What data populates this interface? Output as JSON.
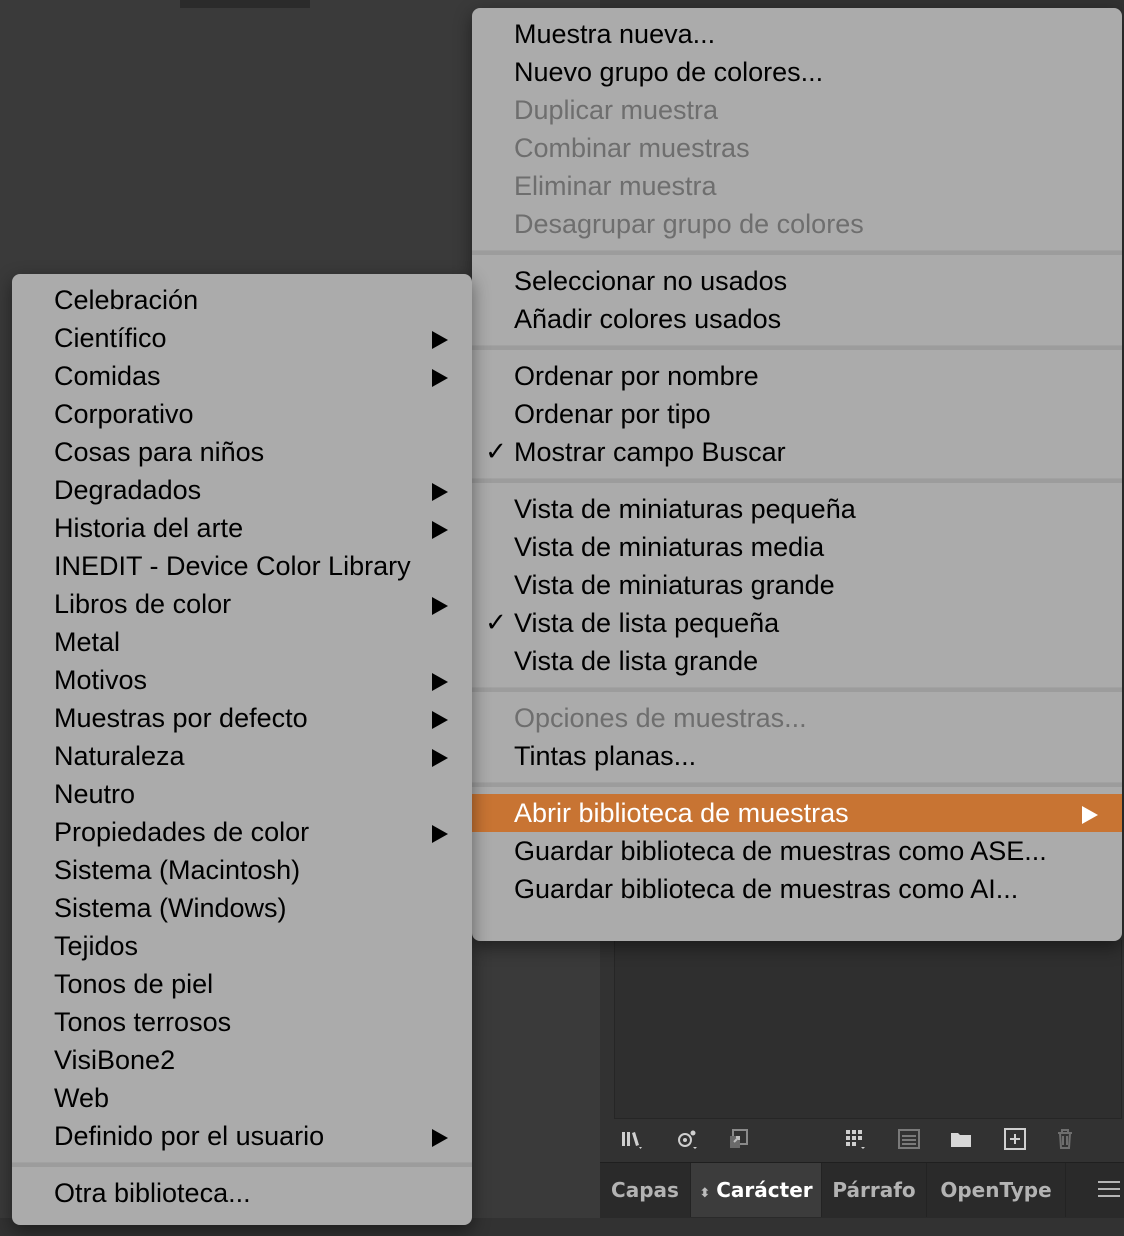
{
  "main_menu": {
    "groups": [
      [
        {
          "label": "Muestra nueva...",
          "enabled": true
        },
        {
          "label": "Nuevo grupo de colores...",
          "enabled": true
        },
        {
          "label": "Duplicar muestra",
          "enabled": false
        },
        {
          "label": "Combinar muestras",
          "enabled": false
        },
        {
          "label": "Eliminar muestra",
          "enabled": false
        },
        {
          "label": "Desagrupar grupo de colores",
          "enabled": false
        }
      ],
      [
        {
          "label": "Seleccionar no usados",
          "enabled": true
        },
        {
          "label": "Añadir colores usados",
          "enabled": true
        }
      ],
      [
        {
          "label": "Ordenar por nombre",
          "enabled": true
        },
        {
          "label": "Ordenar por tipo",
          "enabled": true
        },
        {
          "label": "Mostrar campo Buscar",
          "enabled": true,
          "checked": true
        }
      ],
      [
        {
          "label": "Vista de miniaturas pequeña",
          "enabled": true
        },
        {
          "label": "Vista de miniaturas media",
          "enabled": true
        },
        {
          "label": "Vista de miniaturas grande",
          "enabled": true
        },
        {
          "label": "Vista de lista pequeña",
          "enabled": true,
          "checked": true
        },
        {
          "label": "Vista de lista grande",
          "enabled": true
        }
      ],
      [
        {
          "label": "Opciones de muestras...",
          "enabled": false
        },
        {
          "label": "Tintas planas...",
          "enabled": true
        }
      ],
      [
        {
          "label": "Abrir biblioteca de muestras",
          "enabled": true,
          "highlighted": true,
          "submenu": true
        },
        {
          "label": "Guardar biblioteca de muestras como ASE...",
          "enabled": true
        },
        {
          "label": "Guardar biblioteca de muestras como AI...",
          "enabled": true
        }
      ]
    ]
  },
  "library_submenu": {
    "groups": [
      [
        {
          "label": "Celebración",
          "submenu": false
        },
        {
          "label": "Científico",
          "submenu": true
        },
        {
          "label": "Comidas",
          "submenu": true
        },
        {
          "label": "Corporativo",
          "submenu": false
        },
        {
          "label": "Cosas para niños",
          "submenu": false
        },
        {
          "label": "Degradados",
          "submenu": true
        },
        {
          "label": "Historia del arte",
          "submenu": true
        },
        {
          "label": "INEDIT - Device Color Library",
          "submenu": false
        },
        {
          "label": "Libros de color",
          "submenu": true
        },
        {
          "label": "Metal",
          "submenu": false
        },
        {
          "label": "Motivos",
          "submenu": true
        },
        {
          "label": "Muestras por defecto",
          "submenu": true
        },
        {
          "label": "Naturaleza",
          "submenu": true
        },
        {
          "label": "Neutro",
          "submenu": false
        },
        {
          "label": "Propiedades de color",
          "submenu": true
        },
        {
          "label": "Sistema (Macintosh)",
          "submenu": false
        },
        {
          "label": "Sistema (Windows)",
          "submenu": false
        },
        {
          "label": "Tejidos",
          "submenu": false
        },
        {
          "label": "Tonos de piel",
          "submenu": false
        },
        {
          "label": "Tonos terrosos",
          "submenu": false
        },
        {
          "label": "VisiBone2",
          "submenu": false
        },
        {
          "label": "Web",
          "submenu": false
        },
        {
          "label": "Definido por el usuario",
          "submenu": true
        }
      ],
      [
        {
          "label": "Otra biblioteca...",
          "submenu": false
        }
      ]
    ]
  },
  "panel_toolbar": {
    "icons": [
      "swatch-libraries-icon",
      "show-swatch-kinds-icon",
      "swatch-options-icon",
      "new-color-group-grid-icon",
      "swatch-list-icon",
      "new-color-group-folder-icon",
      "new-swatch-icon",
      "delete-swatch-icon"
    ]
  },
  "tabs": {
    "capas": "Capas",
    "caracter": "Carácter",
    "parrafo": "Párrafo",
    "opentype": "OpenType"
  },
  "colors": {
    "menu_bg": "#ababab",
    "highlight": "#c87433",
    "app_bg": "#3a3a3a"
  }
}
